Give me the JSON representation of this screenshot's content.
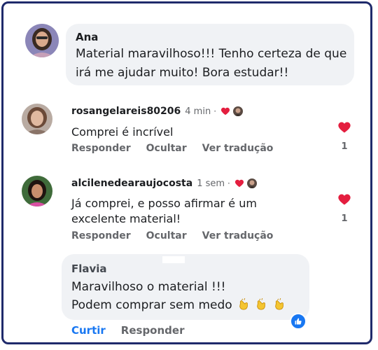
{
  "comments": [
    {
      "author": "Ana",
      "text": "Material maravilhoso!!! Tenho certeza de que irá me ajudar muito! Bora estudar!!"
    },
    {
      "username": "rosangelareis80206",
      "time": "4 min",
      "separator": "·",
      "text": "Comprei é incrível",
      "like_count": "1",
      "actions": [
        "Responder",
        "Ocultar",
        "Ver tradução"
      ]
    },
    {
      "username": "alcilenedearaujocosta",
      "time": "1 sem",
      "separator": "·",
      "text_line1": "Já comprei, e posso afirmar é um",
      "text_line2": "excelente material!",
      "like_count": "1",
      "actions": [
        "Responder",
        "Ocultar",
        "Ver tradução"
      ]
    },
    {
      "author": "Flavia",
      "text_line1": "Maravilhoso o material !!!",
      "text_line2": "Podem comprar sem medo",
      "actions": [
        "Curtir",
        "Responder"
      ]
    }
  ],
  "colors": {
    "heart": "#e41e3f",
    "link_blue": "#1877f2",
    "muted": "#65676b",
    "bubble": "#f0f2f5",
    "frame": "#1f2a6b"
  },
  "icons": {
    "heart": "heart-icon",
    "clap": "clapping-hands-icon",
    "like_badge": "thumbs-up-icon"
  }
}
